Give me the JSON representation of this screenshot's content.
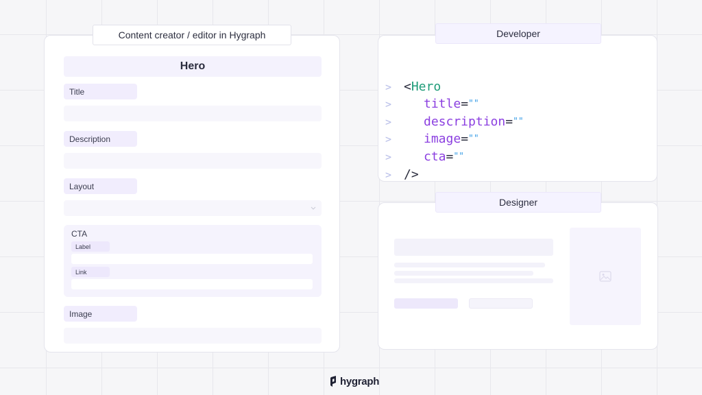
{
  "editor": {
    "tab_label": "Content creator / editor in Hygraph",
    "hero_title": "Hero",
    "fields": {
      "title": "Title",
      "description": "Description",
      "layout": "Layout",
      "cta": "CTA",
      "cta_label": "Label",
      "cta_link": "Link",
      "image": "Image"
    }
  },
  "developer": {
    "tab_label": "Developer",
    "prompt_char": ">",
    "code": {
      "open_lt": "<",
      "component": "Hero",
      "props": [
        {
          "name": "title",
          "eq": "=",
          "quotes": "\"\""
        },
        {
          "name": "description",
          "eq": "=",
          "quotes": "\"\""
        },
        {
          "name": "image",
          "eq": "=",
          "quotes": "\"\""
        },
        {
          "name": "cta",
          "eq": "=",
          "quotes": "\"\""
        }
      ],
      "close": "/>"
    }
  },
  "designer": {
    "tab_label": "Designer"
  },
  "footer": {
    "brand": "hygraph"
  },
  "colors": {
    "accent_purple": "#8b3fe0",
    "component_green": "#1e9b78",
    "quote_blue": "#3b9ee6",
    "lavender": "#f4f2fd"
  }
}
